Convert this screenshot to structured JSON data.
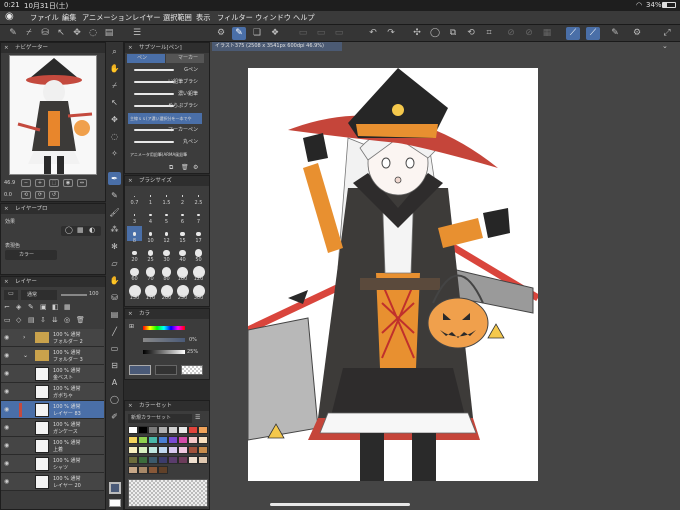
{
  "status": {
    "time": "0:21",
    "date": "10月31日(土)",
    "battery": "34%"
  },
  "menu": [
    "ファイル",
    "編集",
    "アニメーション",
    "レイヤー",
    "選択範囲",
    "表示",
    "フィルター",
    "ウィンドウ",
    "ヘルプ"
  ],
  "navigator": {
    "title": "ナビゲーター",
    "zoom": "46.9",
    "angle": "0.0"
  },
  "layer_property": {
    "title": "レイヤープロ",
    "effect_label": "効果",
    "color_label": "表現色",
    "color_value": "カラー"
  },
  "layers": {
    "title": "レイヤー",
    "blend_mode": "通常",
    "opacity": "100",
    "rows": [
      {
        "opacity": "100 % 通常",
        "name": "フォルダー 2",
        "type": "folder"
      },
      {
        "opacity": "100 % 通常",
        "name": "フォルダー 3",
        "type": "folder"
      },
      {
        "opacity": "100 % 通常",
        "name": "金ベスト",
        "type": "layer"
      },
      {
        "opacity": "100 % 通常",
        "name": "ガボちゃ",
        "type": "layer"
      },
      {
        "opacity": "100 % 通常",
        "name": "レイヤー 83",
        "type": "layer",
        "selected": true
      },
      {
        "opacity": "100 % 通常",
        "name": "ガンケース",
        "type": "layer"
      },
      {
        "opacity": "100 % 通常",
        "name": "上着",
        "type": "layer"
      },
      {
        "opacity": "100 % 通常",
        "name": "シャツ",
        "type": "layer"
      },
      {
        "opacity": "100 % 通常",
        "name": "レイヤー 20",
        "type": "layer"
      }
    ]
  },
  "subtool": {
    "title": "サブツール[ペン]",
    "tabs": [
      "ペン",
      "マーカー"
    ],
    "brushes": [
      "Gペン",
      "丸ペン",
      "濃い鉛筆",
      "めらぷブラシ",
      "主線ｓｓ（ア",
      "マーカーペン",
      "丸ペン",
      "アニメ用ブラシ"
    ],
    "brush_labels_visible": [
      "Gペン",
      "い鉛筆ブラシ",
      "濃い鉛筆",
      "めらぷブラシ",
      "主線ｓｓ(ア濃い選択分を一本でや",
      "マーカーペン",
      "丸ペン",
      "アニメータ用鉛筆(ARMA風鉛筆"
    ]
  },
  "brush_size": {
    "title": "ブラシサイズ",
    "sizes": [
      "0.7",
      "1",
      "1.5",
      "2",
      "2.5",
      "3",
      "4",
      "5",
      "6",
      "7",
      "8",
      "10",
      "12",
      "15",
      "17",
      "20",
      "25",
      "30",
      "40",
      "50",
      "60",
      "70",
      "80",
      "100",
      "120",
      "150",
      "170",
      "200",
      "250",
      "300"
    ]
  },
  "color_slider": {
    "title": "カラ",
    "h": "0%",
    "s": "25%"
  },
  "color_set": {
    "title": "カラーセット",
    "set_name": "新規カラーセット",
    "colors": [
      "#ffffff",
      "#000000",
      "#7b7b7b",
      "#b0b0b0",
      "#d0d0d0",
      "#e8e8e8",
      "#e0443c",
      "#f0a35a",
      "#f4d45c",
      "#8fd14f",
      "#48b8a8",
      "#4a7fd4",
      "#7a4ad4",
      "#d44aa8",
      "#f4c8c8",
      "#f8e0c0",
      "#f8f0c0",
      "#d8f0c0",
      "#c0e8e0",
      "#c0d8f0",
      "#d8c8f0",
      "#f0c8e0",
      "#a0523c",
      "#c88c4c",
      "#6c6c3c",
      "#3c6c3c",
      "#3c5a6c",
      "#3c3c6c",
      "#5a3c6c",
      "#6c3c5a",
      "#f0e0d0",
      "#e0c8b0",
      "#c8a888",
      "#a88868",
      "#885838",
      "#604028"
    ]
  },
  "doc": {
    "tab": "イラスト375 (2508 x 3541px 600dpi 46.9%)"
  },
  "colors": {
    "accent": "#4a6fa8",
    "bg": "#2b2b2b",
    "panel": "#3c3c3c",
    "canvas_bg": "#454545"
  }
}
